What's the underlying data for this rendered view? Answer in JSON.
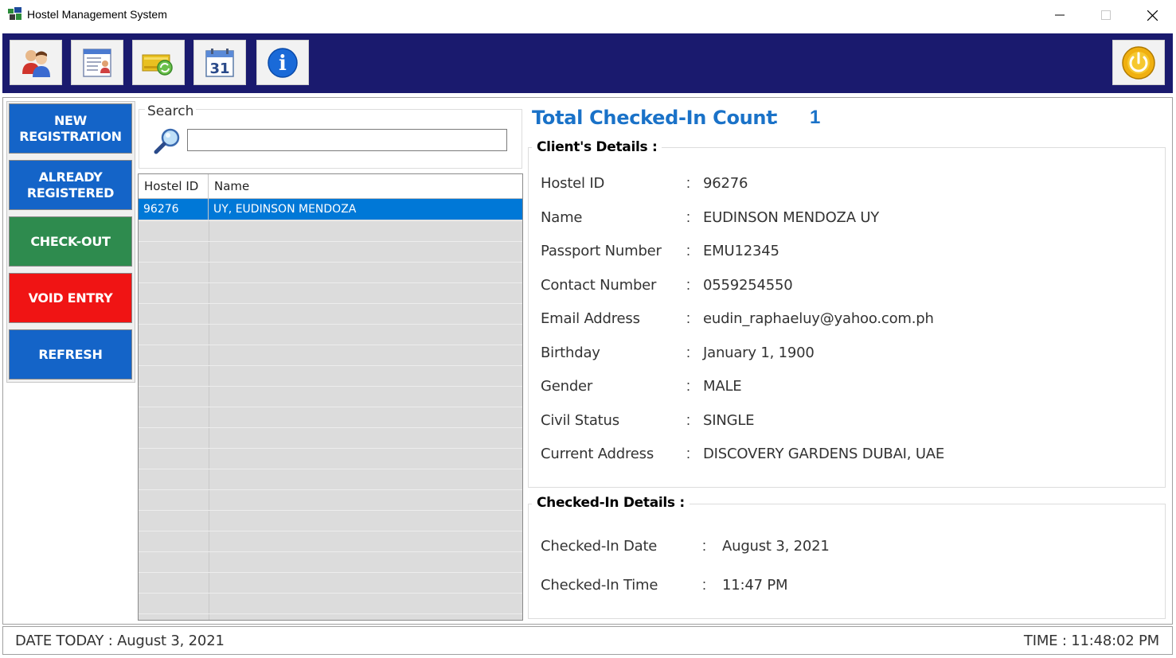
{
  "window": {
    "title": "Hostel Management System"
  },
  "toolbar": {
    "buttons": [
      {
        "icon": "users-icon"
      },
      {
        "icon": "form-icon"
      },
      {
        "icon": "money-refresh-icon"
      },
      {
        "icon": "calendar-icon",
        "text": "31"
      },
      {
        "icon": "info-icon",
        "text": "i"
      }
    ],
    "power": {
      "icon": "power-icon"
    }
  },
  "actions": {
    "new_registration": "NEW\nREGISTRATION",
    "already_registered": "ALREADY\nREGISTERED",
    "check_out": "CHECK-OUT",
    "void_entry": "VOID ENTRY",
    "refresh": "REFRESH"
  },
  "search": {
    "legend": "Search",
    "value": "",
    "placeholder": ""
  },
  "grid": {
    "columns": [
      "Hostel ID",
      "Name"
    ],
    "rows": [
      {
        "hostel_id": "96276",
        "name": "UY, EUDINSON MENDOZA"
      }
    ]
  },
  "summary": {
    "total_label": "Total Checked-In Count",
    "colon": ":",
    "total_value": "1"
  },
  "client": {
    "legend": "Client's Details :",
    "fields": [
      {
        "label": "Hostel ID",
        "value": "96276"
      },
      {
        "label": "Name",
        "value": "EUDINSON MENDOZA UY"
      },
      {
        "label": "Passport Number",
        "value": "EMU12345"
      },
      {
        "label": "Contact Number",
        "value": "0559254550"
      },
      {
        "label": "Email Address",
        "value": "eudin_raphaeluy@yahoo.com.ph"
      },
      {
        "label": "Birthday",
        "value": "January 1, 1900"
      },
      {
        "label": "Gender",
        "value": "MALE"
      },
      {
        "label": "Civil Status",
        "value": "SINGLE"
      },
      {
        "label": "Current Address",
        "value": "DISCOVERY GARDENS DUBAI, UAE"
      }
    ]
  },
  "checkin": {
    "legend": "Checked-In Details :",
    "fields": [
      {
        "label": "Checked-In Date",
        "value": "August 3, 2021"
      },
      {
        "label": "Checked-In Time",
        "value": "11:47 PM"
      }
    ]
  },
  "status": {
    "date": "DATE TODAY : August 3, 2021",
    "time": "TIME : 11:48:02 PM"
  },
  "colors": {
    "toolbar_bg": "#1a1a6e",
    "accent_blue": "#1464c8",
    "green": "#2e8b4e",
    "red": "#f01414",
    "selected_row": "#0078d7",
    "total_text": "#1a72c8"
  }
}
